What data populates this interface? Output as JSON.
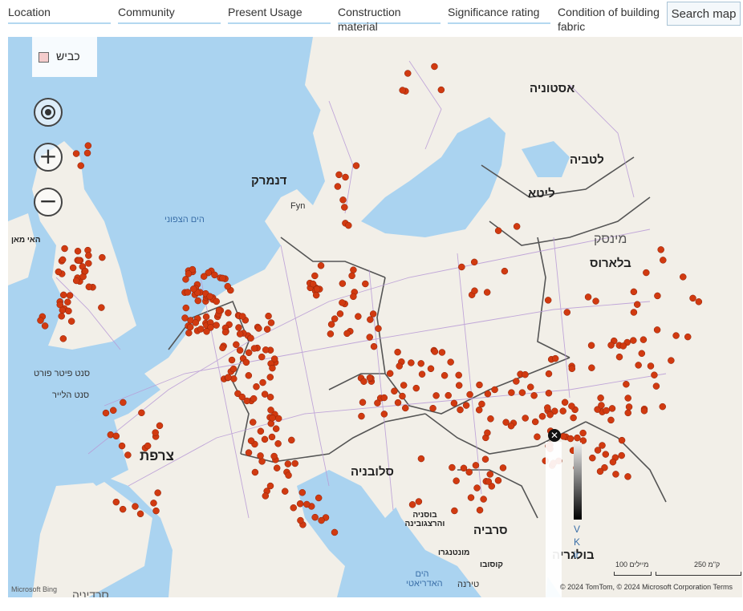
{
  "filters": {
    "location": "Location",
    "community": "Community",
    "present_usage": "Present Usage",
    "construction_material": "Construction material",
    "significance_rating": "Significance rating",
    "condition": "Condition of building fabric",
    "search_button": "Search map"
  },
  "legend": {
    "label": "כביש",
    "swatch_color": "#f4cccc"
  },
  "controls": {
    "locate_icon": "locate-icon",
    "zoom_in_glyph": "+",
    "zoom_out_glyph": "−"
  },
  "labels": {
    "estonia": "אסטוניה",
    "latvia": "לטביה",
    "lithuania": "ליטא",
    "denmark": "דנמרק",
    "fyn": "Fyn",
    "north_sea": "הים הצפוני",
    "isle_of_man": "האי מאן",
    "minsk": "מינסק",
    "belarus": "בלארוס",
    "st_peter_port": "סנט פיטר פורט",
    "st_helier": "סנט הלייר",
    "france": "צרפת",
    "slovenia": "סלובניה",
    "bosnia": "בוסניה והרצגובינה",
    "serbia": "סרביה",
    "montenegro": "מונטנגרו",
    "kosovo": "קוסובו",
    "tirana": "טירנה",
    "adriatic": "הים האדריאטי",
    "bulgaria": "בולגריה",
    "sardinia": "סרדיניה"
  },
  "popup": {
    "close": "✕",
    "text": "V K ir"
  },
  "scale": {
    "miles": "100 מיילים",
    "km": "250 ק\"מ"
  },
  "attribution": {
    "bing": "Microsoft Bing",
    "copyright": "© 2024 TomTom, © 2024 Microsoft Corporation Terms"
  },
  "colors": {
    "marker": "#d13a10",
    "water": "#aad3f0",
    "land": "#f2efe8",
    "border": "#555555",
    "road": "#b89ad6"
  }
}
